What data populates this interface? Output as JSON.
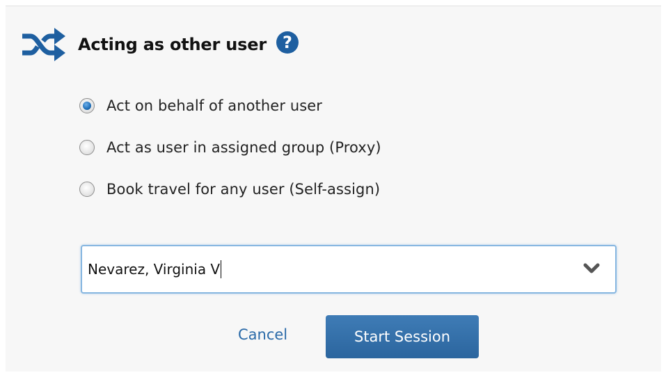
{
  "header": {
    "title": "Acting as other user",
    "help_symbol": "?",
    "shuffle_icon": "shuffle-icon",
    "help_icon": "help-icon"
  },
  "options": [
    {
      "label": "Act on behalf of another user",
      "selected": true
    },
    {
      "label": "Act as user in assigned group (Proxy)",
      "selected": false
    },
    {
      "label": "Book travel for any user (Self-assign)",
      "selected": false
    }
  ],
  "user_select": {
    "value": "Nevarez, Virginia V",
    "dropdown_icon": "chevron-down-icon"
  },
  "actions": {
    "cancel_label": "Cancel",
    "start_label": "Start Session"
  },
  "colors": {
    "accent": "#2b659e",
    "icon_blue": "#1e5fa0",
    "link": "#2a6aa8",
    "panel_bg": "#f7f7f7"
  }
}
